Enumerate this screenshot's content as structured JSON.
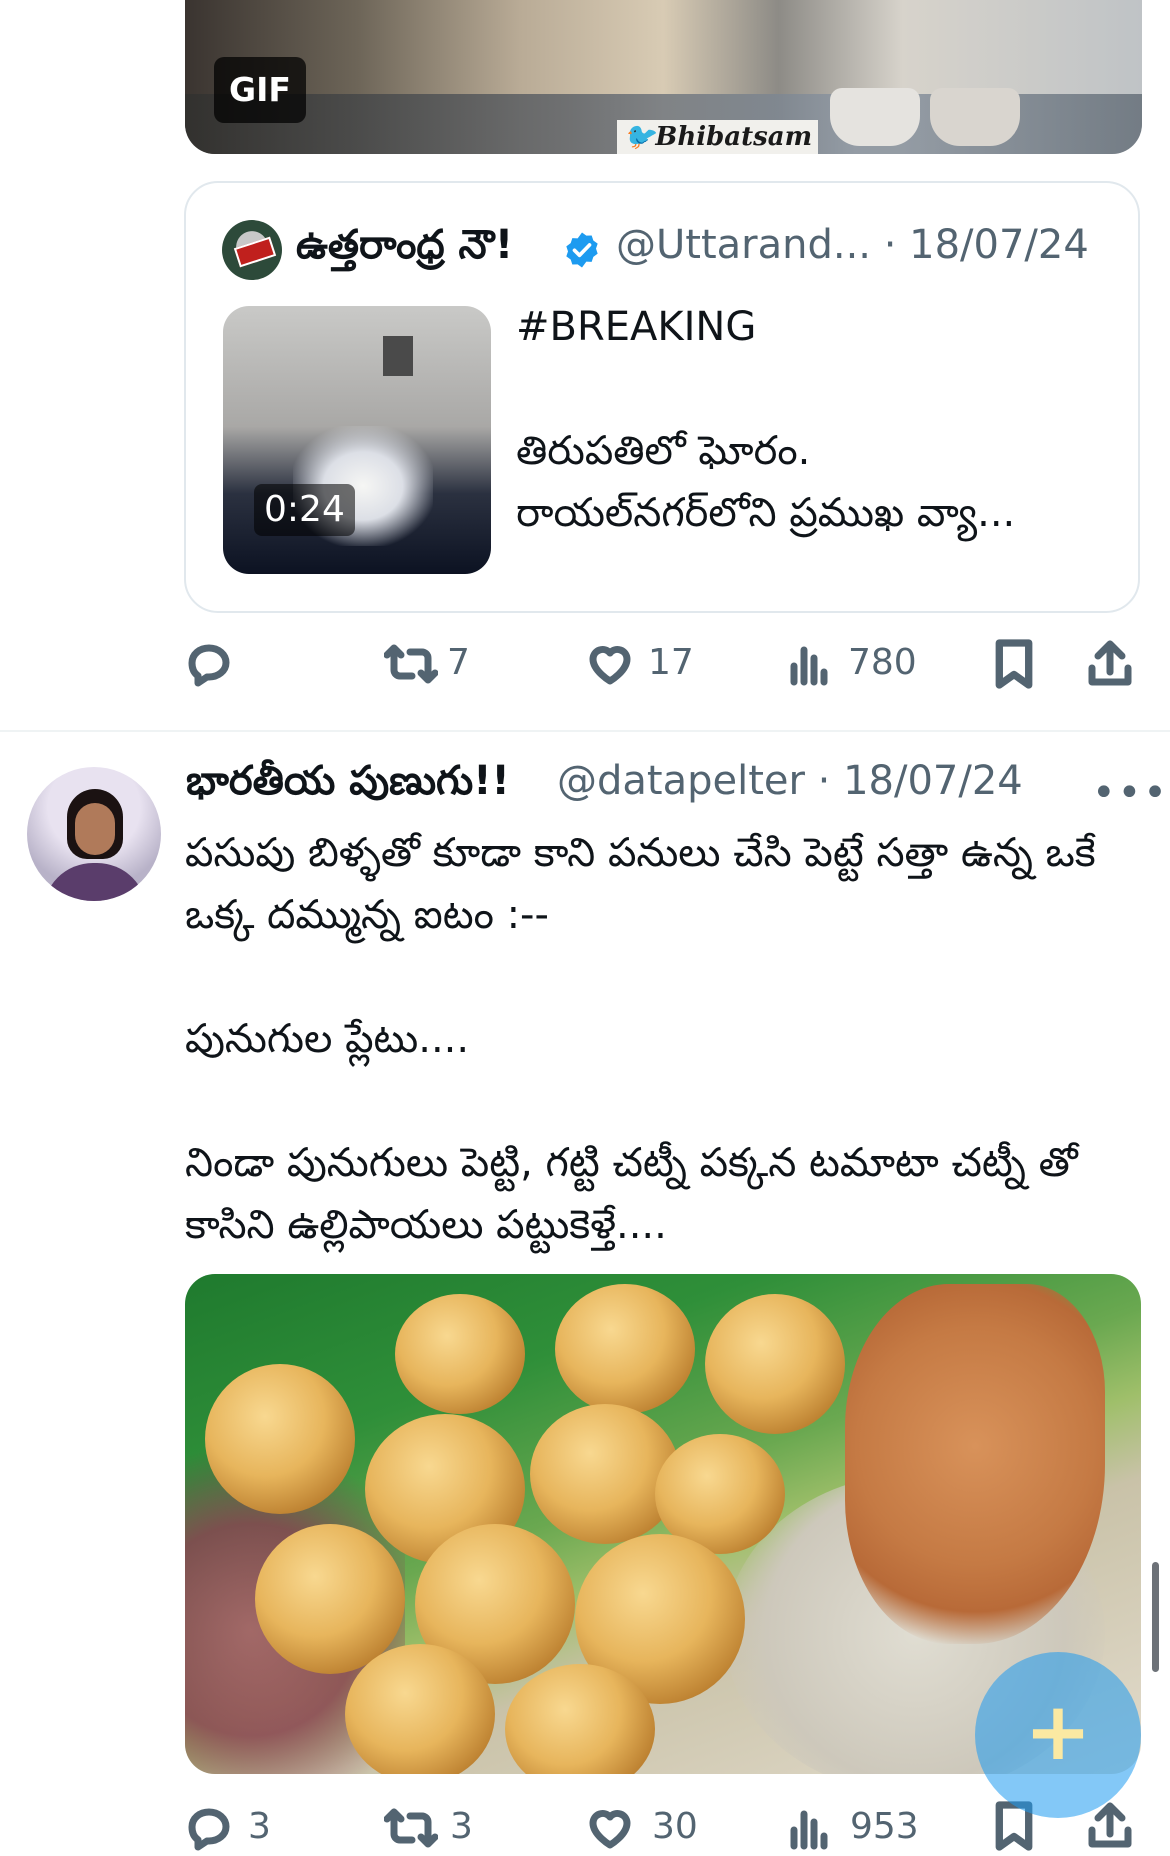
{
  "gif_post": {
    "badge": "GIF",
    "watermark": "Bhibatsam"
  },
  "quoted_tweet": {
    "author": "ఉత్తరాంధ్ర నౌ!",
    "handle_date": "@Uttarand... · 18/07/24",
    "video_duration": "0:24",
    "text": "#BREAKING\n\nతిరుపతిలో ఘోరం.\nరాయల్‌నగర్‌లోని ప్రముఖ వ్యా..."
  },
  "actions_1": {
    "reply_count": "",
    "retweet_count": "7",
    "like_count": "17",
    "views_count": "780"
  },
  "tweet": {
    "author": "భారతీయ పుణుగు!!",
    "handle_date": "@datapelter · 18/07/24",
    "more": "•••",
    "body": "పసుపు బిళ్ళతో కూడా కాని పనులు చేసి పెట్టే సత్తా ఉన్న ఒకే ఒక్క దమ్మున్న ఐటం  :--\n\nపునుగుల ప్లేటు....\n\nనిండా పునుగులు పెట్టి, గట్టి చట్నీ పక్కన టమాటా చట్నీ తో కాసిని ఉల్లిపాయలు పట్టుకెళ్తే...."
  },
  "actions_2": {
    "reply_count": "3",
    "retweet_count": "3",
    "like_count": "30",
    "views_count": "953"
  },
  "fab": {
    "label": "+"
  },
  "colors": {
    "text": "#0f1419",
    "muted": "#536471",
    "border": "#e1e8ed",
    "verified": "#1d9bf0",
    "fab": "#1d9bf0"
  },
  "icons": [
    "reply-icon",
    "retweet-icon",
    "like-icon",
    "views-icon",
    "bookmark-icon",
    "share-icon",
    "verified-icon",
    "more-icon",
    "compose-icon"
  ]
}
